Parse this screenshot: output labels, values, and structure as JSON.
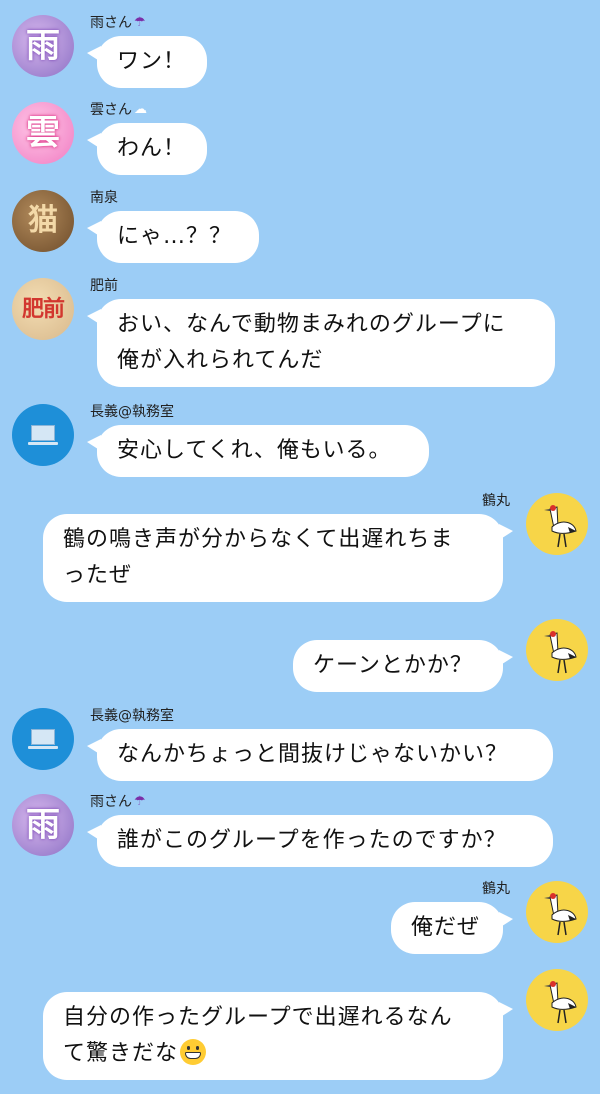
{
  "colors": {
    "background": "#9ccdf6",
    "bubble": "#ffffff",
    "crane_avatar_bg": "#f7d548",
    "chougi_avatar_bg": "#1e8fd8"
  },
  "messages": [
    {
      "side": "left",
      "sender": "雨さん",
      "sender_icon": "umbrella-icon",
      "sender_icon_glyph": "☂",
      "avatar": "ame",
      "avatar_text": "雨",
      "text": "ワン！"
    },
    {
      "side": "left",
      "sender": "雲さん",
      "sender_icon": "cloud-icon",
      "sender_icon_glyph": "☁",
      "avatar": "kumo",
      "avatar_text": "雲",
      "text": "わん！"
    },
    {
      "side": "left",
      "sender": "南泉",
      "avatar": "nansen",
      "avatar_text": "猫",
      "text": "にゃ…？？"
    },
    {
      "side": "left",
      "sender": "肥前",
      "avatar": "hizen",
      "avatar_text": "肥前",
      "text_lines": [
        "おい、なんで動物まみれのグループに",
        "俺が入れられてんだ"
      ]
    },
    {
      "side": "left",
      "sender": "長義@執務室",
      "avatar": "chougi",
      "avatar_icon": "laptop-icon",
      "text": "安心してくれ、俺もいる。"
    },
    {
      "side": "right",
      "sender": "鶴丸",
      "avatar": "tsurumaru",
      "avatar_icon": "crane-icon",
      "text_lines": [
        "鶴の鳴き声が分からなくて出遅れちま",
        "ったぜ"
      ]
    },
    {
      "side": "right",
      "avatar": "tsurumaru",
      "avatar_icon": "crane-icon",
      "text": "ケーンとかか？"
    },
    {
      "side": "left",
      "sender": "長義@執務室",
      "avatar": "chougi",
      "avatar_icon": "laptop-icon",
      "text": "なんかちょっと間抜けじゃないかい？"
    },
    {
      "side": "left",
      "sender": "雨さん",
      "sender_icon": "umbrella-icon",
      "sender_icon_glyph": "☂",
      "avatar": "ame",
      "avatar_text": "雨",
      "text": "誰がこのグループを作ったのですか？"
    },
    {
      "side": "right",
      "sender": "鶴丸",
      "avatar": "tsurumaru",
      "avatar_icon": "crane-icon",
      "text": "俺だぜ"
    },
    {
      "side": "right",
      "avatar": "tsurumaru",
      "avatar_icon": "crane-icon",
      "text_lines": [
        "自分の作ったグループで出遅れるなん",
        "て驚きだな"
      ],
      "trailing_emoji": "grinning-face-emoji"
    }
  ]
}
